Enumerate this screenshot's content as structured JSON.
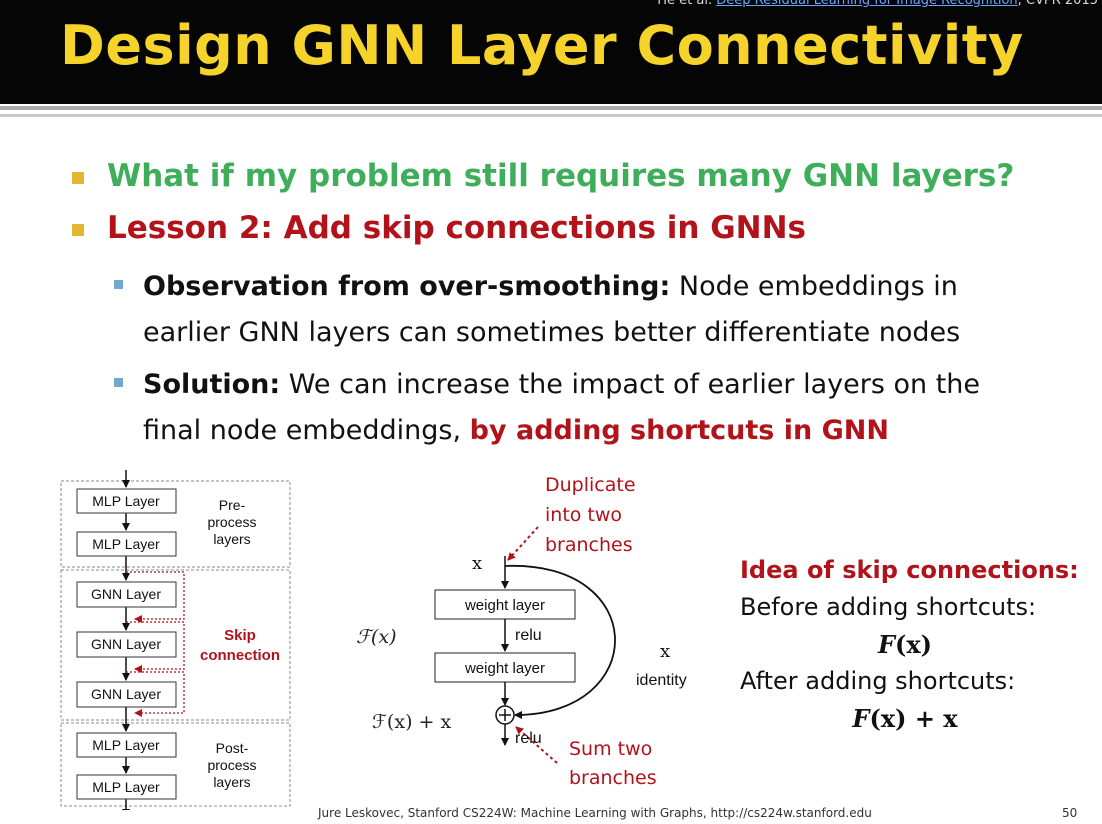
{
  "header": {
    "reference_prefix": "He et al. ",
    "reference_link": "Deep Residual Learning for Image Recognition",
    "reference_suffix": ", CVPR 2015",
    "title": "Design GNN Layer Connectivity"
  },
  "bullets": [
    {
      "text": "What if my problem still requires many GNN layers?",
      "color": "#3fae5a"
    },
    {
      "text": "Lesson 2: Add skip connections in GNNs",
      "color": "#b2121a"
    }
  ],
  "sub_bullets": [
    {
      "bold": "Observation from over-smoothing:",
      "line1_rest": " Node embeddings in",
      "line2": "earlier GNN layers can sometimes better differentiate nodes"
    },
    {
      "bold": "Solution:",
      "line1_rest": " We can increase the impact of earlier layers on the",
      "line2_plain": "final node embeddings, ",
      "line2_red": "by adding shortcuts in GNN"
    }
  ],
  "left_diagram": {
    "blocks": [
      "MLP Layer",
      "MLP Layer",
      "GNN Layer",
      "GNN Layer",
      "GNN Layer",
      "MLP Layer",
      "MLP Layer"
    ],
    "preprocess_label": [
      "Pre-",
      "process",
      "layers"
    ],
    "skip_label": [
      "Skip",
      "connection"
    ],
    "postprocess_label": [
      "Post-",
      "process",
      "layers"
    ]
  },
  "resnet_diagram": {
    "duplicate_note": [
      "Duplicate",
      "into two",
      "branches"
    ],
    "x_top": "x",
    "weight_layer_1": "weight layer",
    "relu_mid": "relu",
    "weight_layer_2": "weight layer",
    "fx_label": "ℱ(x)",
    "x_identity": "x",
    "identity_label": "identity",
    "fx_plus_x": "ℱ(x) + x",
    "relu_bottom": "relu",
    "sum_note": [
      "Sum two",
      "branches"
    ]
  },
  "idea": {
    "title": "Idea of skip connections:",
    "before": "Before adding shortcuts:",
    "formula_before_f": "F",
    "formula_before_rest": "(x)",
    "after": "After adding shortcuts:",
    "formula_after_f": "F",
    "formula_after_rest": "(x) + x"
  },
  "footer": {
    "text": "Jure Leskovec, Stanford CS224W: Machine Learning with Graphs, http://cs224w.stanford.edu",
    "page": "50"
  },
  "colors": {
    "header_bg": "#050505",
    "title": "#f6d32a",
    "green": "#3fae5a",
    "red": "#b2121a",
    "bullet_square": "#e2b72f",
    "sub_bullet_square": "#72a7cf"
  }
}
